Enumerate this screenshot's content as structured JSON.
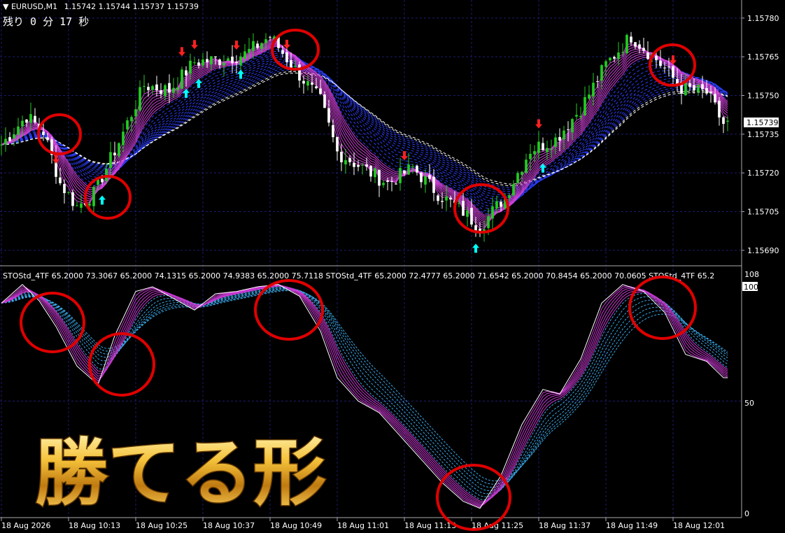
{
  "header": {
    "symbol": "EURUSD,M1",
    "ohlc": "1.15742 1.15744 1.15737 1.15739",
    "remaining": "残り  0 分  17 秒"
  },
  "price_axis": {
    "ticks": [
      "1.15780",
      "1.15765",
      "1.15750",
      "1.15735",
      "1.15720",
      "1.15705",
      "1.15690"
    ],
    "current": "1.15739"
  },
  "indicator": {
    "label": "STOStd_4TF 65.2000 73.3067 65.2000 74.1315 65.2000 74.9383 65.2000 75.7118   STOStd_4TF 65.2000 72.4777 65.2000 71.6542 65.2000 70.8454 65.2000 70.0605   STOStd_4TF 65.2",
    "scale_top": "108",
    "ticks": [
      "100",
      "50",
      "0"
    ]
  },
  "time_axis": {
    "labels": [
      "18 Aug 2026",
      "18 Aug 10:13",
      "18 Aug 10:25",
      "18 Aug 10:37",
      "18 Aug 10:49",
      "18 Aug 11:01",
      "18 Aug 11:13",
      "18 Aug 11:25",
      "18 Aug 11:37",
      "18 Aug 11:49",
      "18 Aug 12:01"
    ]
  },
  "overlay_text": "勝てる形",
  "colors": {
    "background": "#000000",
    "grid": "#1c1c6e",
    "bull": "#22cc22",
    "bear": "#ffffff",
    "magenta": "#cc33cc",
    "blue_band": "#2233dd",
    "cyan": "#33ccee",
    "signal_up": "#00ffff",
    "signal_down": "#ff2020",
    "circle": "#e00000",
    "gold": "#e8b020"
  },
  "chart_data": [
    {
      "type": "candlestick",
      "title": "EURUSD,M1",
      "y_ticks": [
        1.1578,
        1.15765,
        1.1575,
        1.15735,
        1.1572,
        1.15705,
        1.1569
      ],
      "ylim": [
        1.15684,
        1.15787
      ],
      "x_labels": [
        "18 Aug 2026",
        "18 Aug 10:13",
        "18 Aug 10:25",
        "18 Aug 10:37",
        "18 Aug 10:49",
        "18 Aug 11:01",
        "18 Aug 11:13",
        "18 Aug 11:25",
        "18 Aug 11:37",
        "18 Aug 11:49",
        "18 Aug 12:01"
      ],
      "close_path": [
        {
          "i": 0,
          "v": 1.15731
        },
        {
          "i": 6,
          "v": 1.15742
        },
        {
          "i": 10,
          "v": 1.15736
        },
        {
          "i": 14,
          "v": 1.15716
        },
        {
          "i": 18,
          "v": 1.15707
        },
        {
          "i": 22,
          "v": 1.15712
        },
        {
          "i": 28,
          "v": 1.15732
        },
        {
          "i": 34,
          "v": 1.15754
        },
        {
          "i": 40,
          "v": 1.15752
        },
        {
          "i": 46,
          "v": 1.15763
        },
        {
          "i": 52,
          "v": 1.15764
        },
        {
          "i": 58,
          "v": 1.15766
        },
        {
          "i": 64,
          "v": 1.15773
        },
        {
          "i": 70,
          "v": 1.1576
        },
        {
          "i": 76,
          "v": 1.15748
        },
        {
          "i": 80,
          "v": 1.15728
        },
        {
          "i": 86,
          "v": 1.15722
        },
        {
          "i": 92,
          "v": 1.15716
        },
        {
          "i": 98,
          "v": 1.15722
        },
        {
          "i": 104,
          "v": 1.15712
        },
        {
          "i": 110,
          "v": 1.15705
        },
        {
          "i": 114,
          "v": 1.15699
        },
        {
          "i": 120,
          "v": 1.15711
        },
        {
          "i": 126,
          "v": 1.15729
        },
        {
          "i": 132,
          "v": 1.15733
        },
        {
          "i": 138,
          "v": 1.15745
        },
        {
          "i": 144,
          "v": 1.15762
        },
        {
          "i": 150,
          "v": 1.15773
        },
        {
          "i": 156,
          "v": 1.15764
        },
        {
          "i": 162,
          "v": 1.15753
        },
        {
          "i": 168,
          "v": 1.15751
        },
        {
          "i": 172,
          "v": 1.15739
        }
      ],
      "signals_up": [
        24,
        44,
        47,
        57,
        113,
        129
      ],
      "signals_down": [
        13,
        43,
        46,
        56,
        68,
        96,
        128,
        160
      ]
    },
    {
      "type": "line",
      "title": "STOStd_4TF",
      "y_ticks": [
        100,
        50,
        0
      ],
      "ylim": [
        0,
        108
      ],
      "main_path": [
        {
          "i": 0,
          "v": 92
        },
        {
          "i": 5,
          "v": 100
        },
        {
          "i": 9,
          "v": 93
        },
        {
          "i": 13,
          "v": 82
        },
        {
          "i": 18,
          "v": 65
        },
        {
          "i": 23,
          "v": 57
        },
        {
          "i": 27,
          "v": 78
        },
        {
          "i": 32,
          "v": 97
        },
        {
          "i": 36,
          "v": 99
        },
        {
          "i": 41,
          "v": 94
        },
        {
          "i": 46,
          "v": 89
        },
        {
          "i": 51,
          "v": 96
        },
        {
          "i": 56,
          "v": 97
        },
        {
          "i": 61,
          "v": 99
        },
        {
          "i": 66,
          "v": 100
        },
        {
          "i": 71,
          "v": 95
        },
        {
          "i": 76,
          "v": 80
        },
        {
          "i": 80,
          "v": 60
        },
        {
          "i": 85,
          "v": 50
        },
        {
          "i": 90,
          "v": 45
        },
        {
          "i": 95,
          "v": 35
        },
        {
          "i": 100,
          "v": 25
        },
        {
          "i": 105,
          "v": 15
        },
        {
          "i": 110,
          "v": 7
        },
        {
          "i": 114,
          "v": 4
        },
        {
          "i": 119,
          "v": 18
        },
        {
          "i": 124,
          "v": 40
        },
        {
          "i": 129,
          "v": 55
        },
        {
          "i": 133,
          "v": 53
        },
        {
          "i": 138,
          "v": 68
        },
        {
          "i": 143,
          "v": 92
        },
        {
          "i": 148,
          "v": 100
        },
        {
          "i": 153,
          "v": 97
        },
        {
          "i": 158,
          "v": 88
        },
        {
          "i": 163,
          "v": 70
        },
        {
          "i": 168,
          "v": 67
        },
        {
          "i": 172,
          "v": 60
        }
      ]
    }
  ]
}
